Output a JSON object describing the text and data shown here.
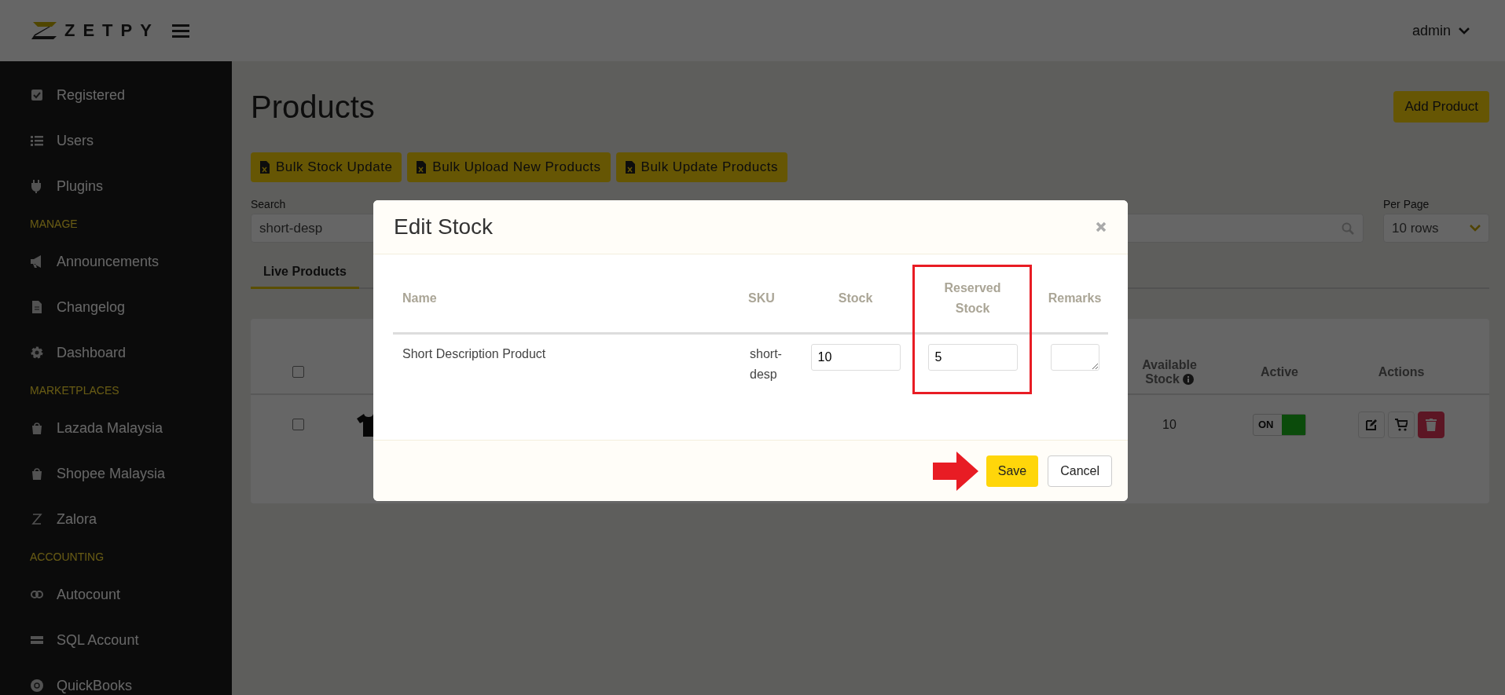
{
  "header": {
    "logo": "ZETPY",
    "user": "admin"
  },
  "sidebar": {
    "groups": [
      {
        "items": [
          {
            "label": "Registered"
          },
          {
            "label": "Users"
          },
          {
            "label": "Plugins"
          }
        ]
      },
      {
        "heading": "MANAGE",
        "items": [
          {
            "label": "Announcements"
          },
          {
            "label": "Changelog"
          },
          {
            "label": "Dashboard"
          }
        ]
      },
      {
        "heading": "MARKETPLACES",
        "items": [
          {
            "label": "Lazada Malaysia"
          },
          {
            "label": "Shopee Malaysia"
          },
          {
            "label": "Zalora"
          }
        ]
      },
      {
        "heading": "ACCOUNTING",
        "items": [
          {
            "label": "Autocount"
          },
          {
            "label": "SQL Account"
          },
          {
            "label": "QuickBooks"
          }
        ]
      }
    ]
  },
  "page": {
    "title": "Products",
    "add_button": "Add Product",
    "bulk_buttons": [
      "Bulk Stock Update",
      "Bulk Upload New Products",
      "Bulk Update Products"
    ],
    "search": {
      "label": "Search",
      "value": "short-desp"
    },
    "per_page": {
      "label": "Per Page",
      "value": "10 rows"
    },
    "tabs": [
      {
        "label": "Live Products",
        "selected": true
      }
    ],
    "table": {
      "header_checked": false,
      "columns": [
        "Available Stock",
        "Active",
        "Actions"
      ],
      "rows": [
        {
          "checked": false,
          "available_stock": "10",
          "active": true,
          "active_label": "ON"
        }
      ]
    }
  },
  "modal": {
    "title": "Edit Stock",
    "columns": [
      {
        "label": "Name",
        "highlighted": false
      },
      {
        "label": "SKU",
        "highlighted": false
      },
      {
        "label": "Stock",
        "highlighted": false
      },
      {
        "label": "Reserved Stock",
        "highlighted": true
      },
      {
        "label": "Remarks",
        "highlighted": false
      }
    ],
    "rows": [
      {
        "name": "Short Description Product",
        "sku": "short-desp",
        "stock": "10",
        "reserved_stock": "5"
      }
    ],
    "buttons": [
      {
        "label": "Save",
        "kind": "primary",
        "pointed": true
      },
      {
        "label": "Cancel",
        "kind": "secondary",
        "pointed": false
      }
    ]
  }
}
